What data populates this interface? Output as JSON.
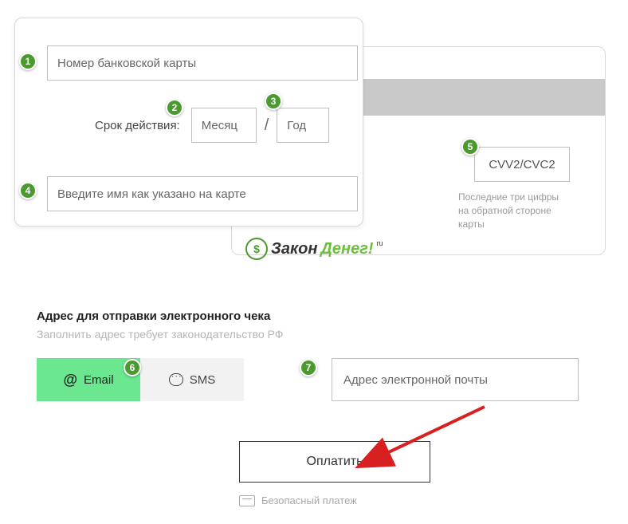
{
  "card": {
    "number_placeholder": "Номер банковской карты",
    "expiry_label": "Срок действия:",
    "month_placeholder": "Месяц",
    "year_placeholder": "Год",
    "name_placeholder": "Введите имя как указано на карте",
    "cvv_placeholder": "CVV2/CVC2",
    "cvv_hint": "Последние три цифры на обратной стороне карты"
  },
  "logo": {
    "text1": "Закон",
    "text2": "Денег!",
    "suffix": "ru"
  },
  "receipt": {
    "title": "Адрес для отправки электронного чека",
    "subtitle": "Заполнить адрес требует законодательство РФ",
    "tab_email": "Email",
    "tab_sms": "SMS",
    "email_placeholder": "Адрес электронной почты"
  },
  "pay_button": "Оплатить",
  "secure_text": "Безопасный платеж",
  "badges": {
    "b1": "1",
    "b2": "2",
    "b3": "3",
    "b4": "4",
    "b5": "5",
    "b6": "6",
    "b7": "7"
  }
}
